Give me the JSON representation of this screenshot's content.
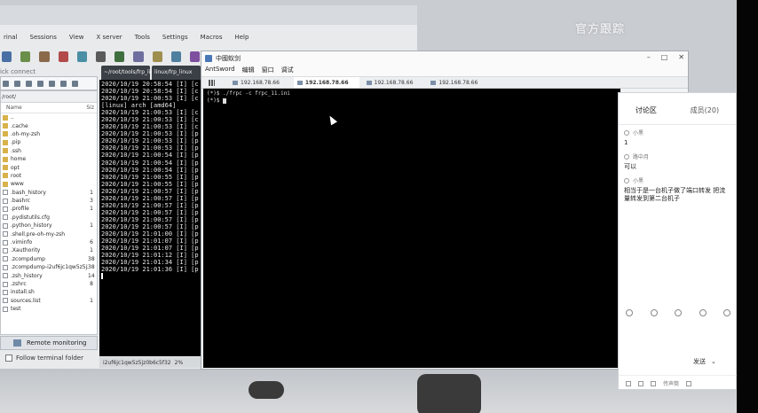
{
  "overlay": {
    "watermark": "官方跟踪"
  },
  "moba": {
    "menu": [
      "rinal",
      "Sessions",
      "View",
      "X server",
      "Tools",
      "Settings",
      "Macros",
      "Help"
    ],
    "quick_connect": "ick connect",
    "sftp_path": "/root/",
    "col_name": "Name",
    "col_size": "Siz",
    "files": [
      {
        "name": "..",
        "size": "",
        "type": "dir"
      },
      {
        "name": ".cache",
        "size": "",
        "type": "dir"
      },
      {
        "name": ".oh-my-zsh",
        "size": "",
        "type": "dir"
      },
      {
        "name": ".pip",
        "size": "",
        "type": "dir"
      },
      {
        "name": ".ssh",
        "size": "",
        "type": "dir"
      },
      {
        "name": "home",
        "size": "",
        "type": "dir"
      },
      {
        "name": "opt",
        "size": "",
        "type": "dir"
      },
      {
        "name": "root",
        "size": "",
        "type": "dir"
      },
      {
        "name": "www",
        "size": "",
        "type": "dir"
      },
      {
        "name": ".bash_history",
        "size": "1",
        "type": "file"
      },
      {
        "name": ".bashrc",
        "size": "3",
        "type": "file"
      },
      {
        "name": ".profile",
        "size": "1",
        "type": "file"
      },
      {
        "name": ".pydistutils.cfg",
        "size": "",
        "type": "file"
      },
      {
        "name": ".python_history",
        "size": "1",
        "type": "file"
      },
      {
        "name": ".shell.pre-oh-my-zsh",
        "size": "",
        "type": "file"
      },
      {
        "name": ".viminfo",
        "size": "6",
        "type": "file"
      },
      {
        "name": ".Xauthority",
        "size": "1",
        "type": "file"
      },
      {
        "name": ".zcompdump",
        "size": "38",
        "type": "file"
      },
      {
        "name": ".zcompdump-i2uf6jc1qw5z5jz0...",
        "size": "38",
        "type": "file"
      },
      {
        "name": ".zsh_history",
        "size": "14",
        "type": "file"
      },
      {
        "name": ".zshrc",
        "size": "8",
        "type": "file"
      },
      {
        "name": "install.sh",
        "size": "",
        "type": "file"
      },
      {
        "name": "sources.list",
        "size": "1",
        "type": "file"
      },
      {
        "name": "test",
        "size": "",
        "type": "file"
      }
    ],
    "remote_monitoring": "Remote monitoring",
    "follow_folder": "Follow terminal folder",
    "term_tab1": "~/root/tools/frp_linu",
    "term_tab2": "linux/frp_linux",
    "term_lines": [
      "2020/10/19 20:58:54 [I] [c",
      "2020/10/19 20:58:54 [I] [c",
      "2020/10/19 21:00:53 [I] [c",
      "[linux] arch [amd64]",
      "2020/10/19 21:00:53 [I] [c",
      "2020/10/19 21:00:53 [I] [c",
      "2020/10/19 21:00:53 [I] [c",
      "2020/10/19 21:00:53 [I] [p",
      "2020/10/19 21:00:53 [I] [p",
      "2020/10/19 21:00:53 [I] [p",
      "2020/10/19 21:00:54 [I] [p",
      "2020/10/19 21:00:54 [I] [p",
      "2020/10/19 21:00:54 [I] [p",
      "2020/10/19 21:00:55 [I] [p",
      "2020/10/19 21:00:55 [I] [p",
      "2020/10/19 21:00:57 [I] [p",
      "2020/10/19 21:00:57 [I] [p",
      "2020/10/19 21:00:57 [I] [p",
      "2020/10/19 21:00:57 [I] [p",
      "2020/10/19 21:00:57 [I] [p",
      "2020/10/19 21:00:57 [I] [p",
      "2020/10/19 21:01:00 [I] [p",
      "2020/10/19 21:01:07 [I] [p",
      "2020/10/19 21:01:07 [I] [p",
      "2020/10/19 21:01:12 [I] [p",
      "2020/10/19 21:01:34 [I] [p",
      "2020/10/19 21:01:36 [I] [p"
    ],
    "status_text": "i2uf6jc1qw5z5jz0b6c5f32",
    "status_pct": "2%"
  },
  "ant": {
    "title": "中國蚁剑",
    "menu": [
      "AntSword",
      "编辑",
      "窗口",
      "调试"
    ],
    "tabs": [
      "192.168.78.66",
      "192.168.78.66",
      "192.168.78.66",
      "192.168.78.66"
    ],
    "term_lines": [
      "(*)$ ./frpc -c frpc_11.ini",
      "(*)$"
    ]
  },
  "disc": {
    "tab_discussion": "讨论区",
    "tab_members": "成员(20)",
    "messages": [
      {
        "user": "小黑",
        "text": "1"
      },
      {
        "user": "路中月",
        "text": "可以"
      },
      {
        "user": "小黑",
        "text": "相当于是一台机子做了端口转发 把流量转发到第二台机子"
      }
    ],
    "send": "发送",
    "bottom_text": "传声筒"
  }
}
